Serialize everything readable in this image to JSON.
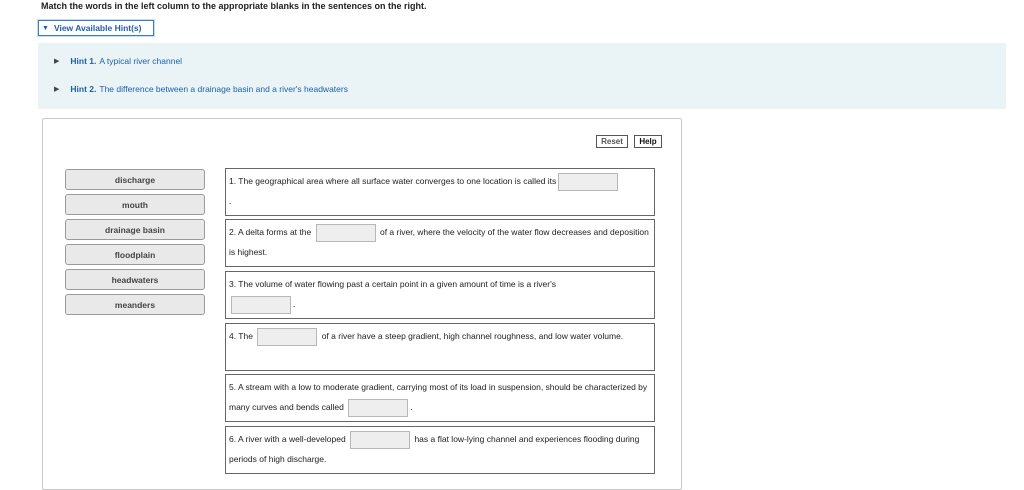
{
  "instructions": "Match the words in the left column to the appropriate blanks in the sentences on the right.",
  "hints_toggle": {
    "label": "View Available Hint(s)",
    "icon": "caret-down-icon"
  },
  "hints": [
    {
      "number": "Hint 1.",
      "text": "A typical river channel"
    },
    {
      "number": "Hint 2.",
      "text": "The difference between a drainage basin and a river's headwaters"
    }
  ],
  "toolbar": {
    "reset_label": "Reset",
    "help_label": "Help"
  },
  "word_bank": [
    "discharge",
    "mouth",
    "drainage basin",
    "floodplain",
    "headwaters",
    "meanders"
  ],
  "sentences": [
    {
      "before": "1. The geographical area where all surface water converges to one location is called its",
      "after": "."
    },
    {
      "before": "2. A delta forms at the",
      "after": "of a river, where the velocity of the water flow decreases and deposition is highest."
    },
    {
      "before": "3. The volume of water flowing past a certain point in a given amount of time is a river's",
      "after": "."
    },
    {
      "before": "4. The",
      "after": "of a river have a steep gradient, high channel roughness, and low water volume."
    },
    {
      "before": "5. A stream with a low to moderate gradient, carrying most of its load in suspension, should be characterized by many curves and bends called",
      "after": "."
    },
    {
      "before": "6. A river with a well-developed",
      "after": "has a flat low-lying channel and experiences flooding during periods of high discharge."
    }
  ],
  "colors": {
    "link": "#1f5fa8",
    "hint_panel_bg": "#eaf4f6",
    "tile_bg": "#e9e9e9"
  }
}
